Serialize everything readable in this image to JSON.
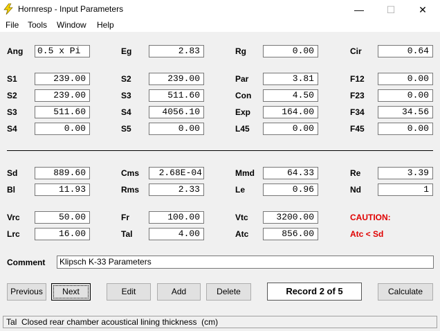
{
  "window": {
    "title": "Hornresp - Input Parameters",
    "minimize": "—",
    "maximize": "☐",
    "close": "✕"
  },
  "menu": {
    "file": "File",
    "tools": "Tools",
    "window": "Window",
    "help": "Help"
  },
  "params": {
    "ang": {
      "label": "Ang",
      "value": "0.5 x Pi"
    },
    "eg": {
      "label": "Eg",
      "value": "2.83"
    },
    "rg": {
      "label": "Rg",
      "value": "0.00"
    },
    "cir": {
      "label": "Cir",
      "value": "0.64"
    },
    "s1a": {
      "label": "S1",
      "value": "239.00"
    },
    "s2a": {
      "label": "S2",
      "value": "239.00"
    },
    "par": {
      "label": "Par",
      "value": "3.81"
    },
    "f12": {
      "label": "F12",
      "value": "0.00"
    },
    "s2b": {
      "label": "S2",
      "value": "239.00"
    },
    "s3a": {
      "label": "S3",
      "value": "511.60"
    },
    "con": {
      "label": "Con",
      "value": "4.50"
    },
    "f23": {
      "label": "F23",
      "value": "0.00"
    },
    "s3b": {
      "label": "S3",
      "value": "511.60"
    },
    "s4a": {
      "label": "S4",
      "value": "4056.10"
    },
    "exp": {
      "label": "Exp",
      "value": "164.00"
    },
    "f34": {
      "label": "F34",
      "value": "34.56"
    },
    "s4b": {
      "label": "S4",
      "value": "0.00"
    },
    "s5": {
      "label": "S5",
      "value": "0.00"
    },
    "l45": {
      "label": "L45",
      "value": "0.00"
    },
    "f45": {
      "label": "F45",
      "value": "0.00"
    },
    "sd": {
      "label": "Sd",
      "value": "889.60"
    },
    "cms": {
      "label": "Cms",
      "value": "2.68E-04"
    },
    "mmd": {
      "label": "Mmd",
      "value": "64.33"
    },
    "re": {
      "label": "Re",
      "value": "3.39"
    },
    "bl": {
      "label": "Bl",
      "value": "11.93"
    },
    "rms": {
      "label": "Rms",
      "value": "2.33"
    },
    "le": {
      "label": "Le",
      "value": "0.96"
    },
    "nd": {
      "label": "Nd",
      "value": "1"
    },
    "vrc": {
      "label": "Vrc",
      "value": "50.00"
    },
    "fr": {
      "label": "Fr",
      "value": "100.00"
    },
    "vtc": {
      "label": "Vtc",
      "value": "3200.00"
    },
    "lrc": {
      "label": "Lrc",
      "value": "16.00"
    },
    "tal": {
      "label": "Tal",
      "value": "4.00"
    },
    "atc": {
      "label": "Atc",
      "value": "856.00"
    }
  },
  "caution": {
    "title": "CAUTION:",
    "message": "Atc < Sd",
    "color": "#e00000"
  },
  "comment": {
    "label": "Comment",
    "value": "Klipsch K-33 Parameters"
  },
  "buttons": {
    "previous": "Previous",
    "next": "Next",
    "edit": "Edit",
    "add": "Add",
    "delete": "Delete",
    "calculate": "Calculate"
  },
  "record": "Record 2 of 5",
  "status": "Tal  Closed rear chamber acoustical lining thickness  (cm)"
}
